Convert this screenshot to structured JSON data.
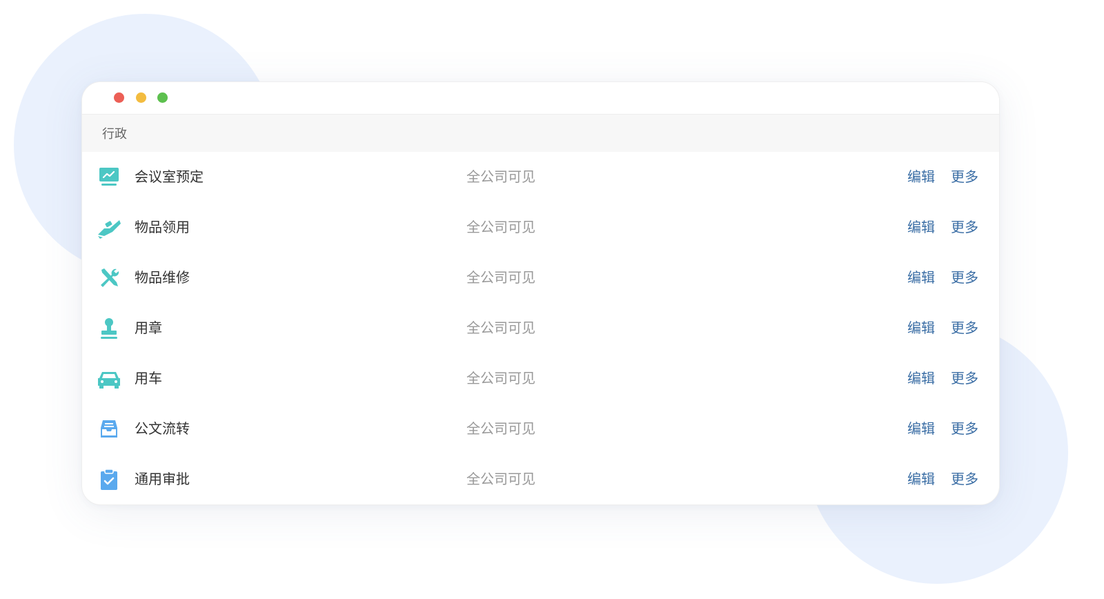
{
  "section": {
    "title": "行政"
  },
  "colors": {
    "accent_teal": "#4cc7c4",
    "accent_blue": "#5aa9ee",
    "link": "#3b6ea5",
    "muted": "#999999"
  },
  "rows": [
    {
      "icon": "meeting-room-icon",
      "name": "会议室预定",
      "visibility": "全公司可见",
      "edit": "编辑",
      "more": "更多"
    },
    {
      "icon": "handover-icon",
      "name": "物品领用",
      "visibility": "全公司可见",
      "edit": "编辑",
      "more": "更多"
    },
    {
      "icon": "tools-icon",
      "name": "物品维修",
      "visibility": "全公司可见",
      "edit": "编辑",
      "more": "更多"
    },
    {
      "icon": "stamp-icon",
      "name": "用章",
      "visibility": "全公司可见",
      "edit": "编辑",
      "more": "更多"
    },
    {
      "icon": "car-icon",
      "name": "用车",
      "visibility": "全公司可见",
      "edit": "编辑",
      "more": "更多"
    },
    {
      "icon": "inbox-icon",
      "name": "公文流转",
      "visibility": "全公司可见",
      "edit": "编辑",
      "more": "更多"
    },
    {
      "icon": "clipboard-check-icon",
      "name": "通用审批",
      "visibility": "全公司可见",
      "edit": "编辑",
      "more": "更多"
    }
  ]
}
